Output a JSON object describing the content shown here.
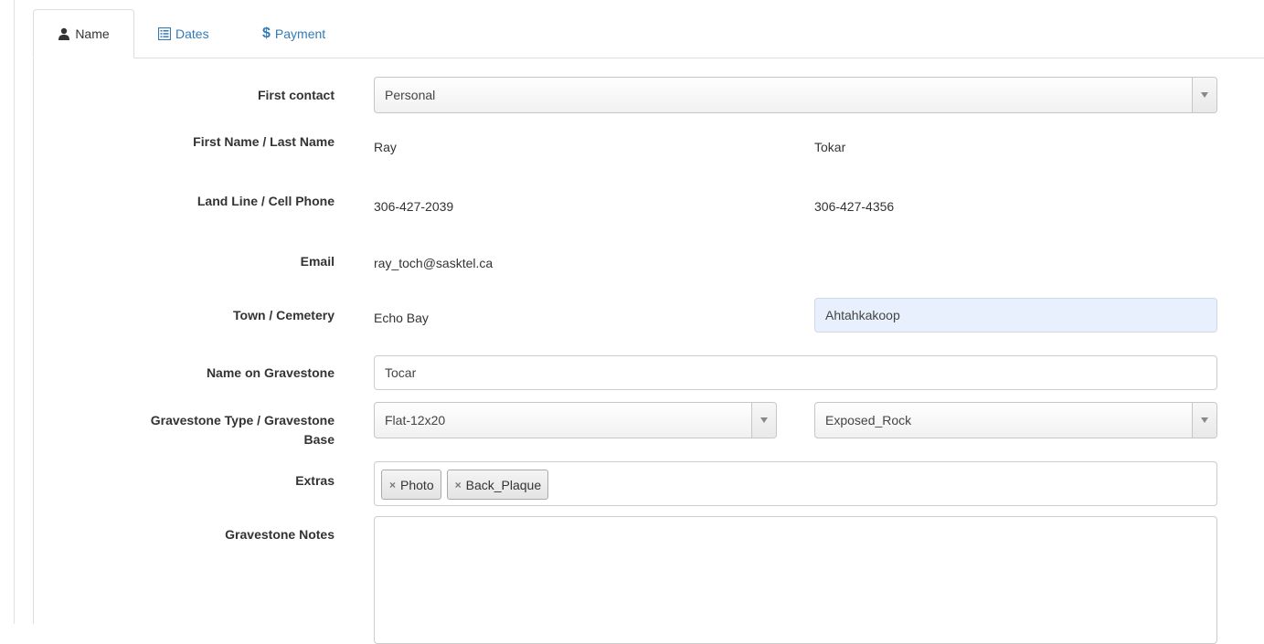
{
  "tabs": [
    {
      "label": "Name",
      "icon": "user-icon",
      "active": true
    },
    {
      "label": "Dates",
      "icon": "calendar-list-icon",
      "active": false
    },
    {
      "label": "Payment",
      "icon": "dollar-icon",
      "active": false
    }
  ],
  "colors": {
    "link": "#337ab7",
    "autofill": "#e8f0fe",
    "border": "#cccccc"
  },
  "form": {
    "first_contact": {
      "label": "First contact",
      "value": "Personal"
    },
    "name": {
      "label": "First Name / Last Name",
      "first": "Ray",
      "last": "Tokar"
    },
    "phone": {
      "label": "Land Line / Cell Phone",
      "land": "306-427-2039",
      "cell": "306-427-4356"
    },
    "email": {
      "label": "Email",
      "value": "ray_toch@sasktel.ca"
    },
    "town": {
      "label": "Town / Cemetery",
      "town": "Echo Bay",
      "cemetery": "Ahtahkakoop"
    },
    "gravestone_name": {
      "label": "Name on Gravestone",
      "value": "Tocar"
    },
    "gravestone_type": {
      "label_line1": "Gravestone Type / Gravestone",
      "label_line2": "Base",
      "type": "Flat-12x20",
      "base": "Exposed_Rock"
    },
    "extras": {
      "label": "Extras",
      "tags": [
        "Photo",
        "Back_Plaque"
      ]
    },
    "notes": {
      "label": "Gravestone Notes",
      "value": ""
    }
  }
}
